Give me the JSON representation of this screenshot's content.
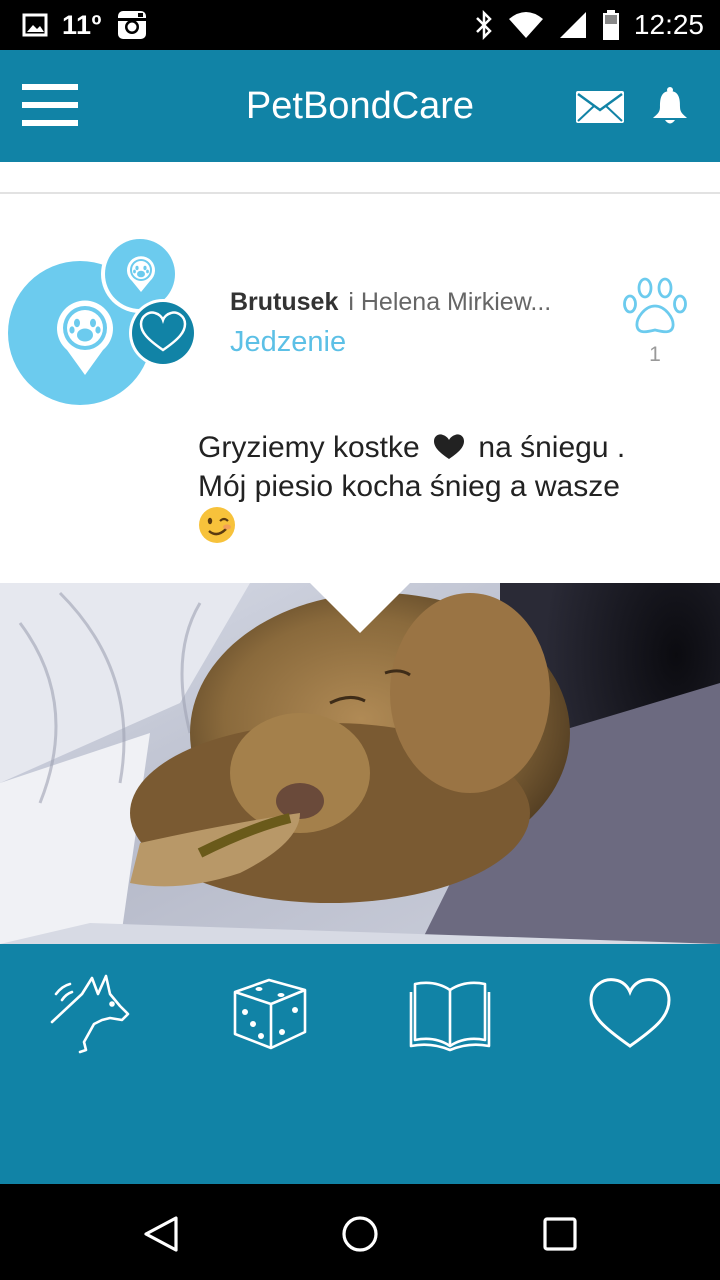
{
  "status_bar": {
    "temperature": "11º",
    "time": "12:25",
    "icons": [
      "image-icon",
      "instagram-icon",
      "bluetooth-icon",
      "wifi-icon",
      "signal-icon",
      "battery-icon"
    ]
  },
  "app_bar": {
    "title": "PetBondCare",
    "icons": [
      "menu-icon",
      "mail-icon",
      "bell-icon"
    ]
  },
  "post": {
    "author": "Brutusek",
    "co_author": "i Helena Mirkiew...",
    "category": "Jedzenie",
    "like_count": "1",
    "text_line1_before": "Gryziemy kostke",
    "text_line1_after": "na śniegu .",
    "text_line2": "Mój piesio kocha śnieg a wasze",
    "emoji": "wink-emoji",
    "photo": "sleeping-dog-in-snow"
  },
  "bottom_tabs": [
    {
      "icon": "dog-icon"
    },
    {
      "icon": "dice-icon"
    },
    {
      "icon": "book-icon"
    },
    {
      "icon": "heart-icon"
    }
  ],
  "nav_bar": {
    "icons": [
      "back-icon",
      "home-icon",
      "recents-icon"
    ]
  },
  "colors": {
    "primary": "#1183a6",
    "accent": "#5cc0e6",
    "light_blue": "#6ccbee"
  }
}
